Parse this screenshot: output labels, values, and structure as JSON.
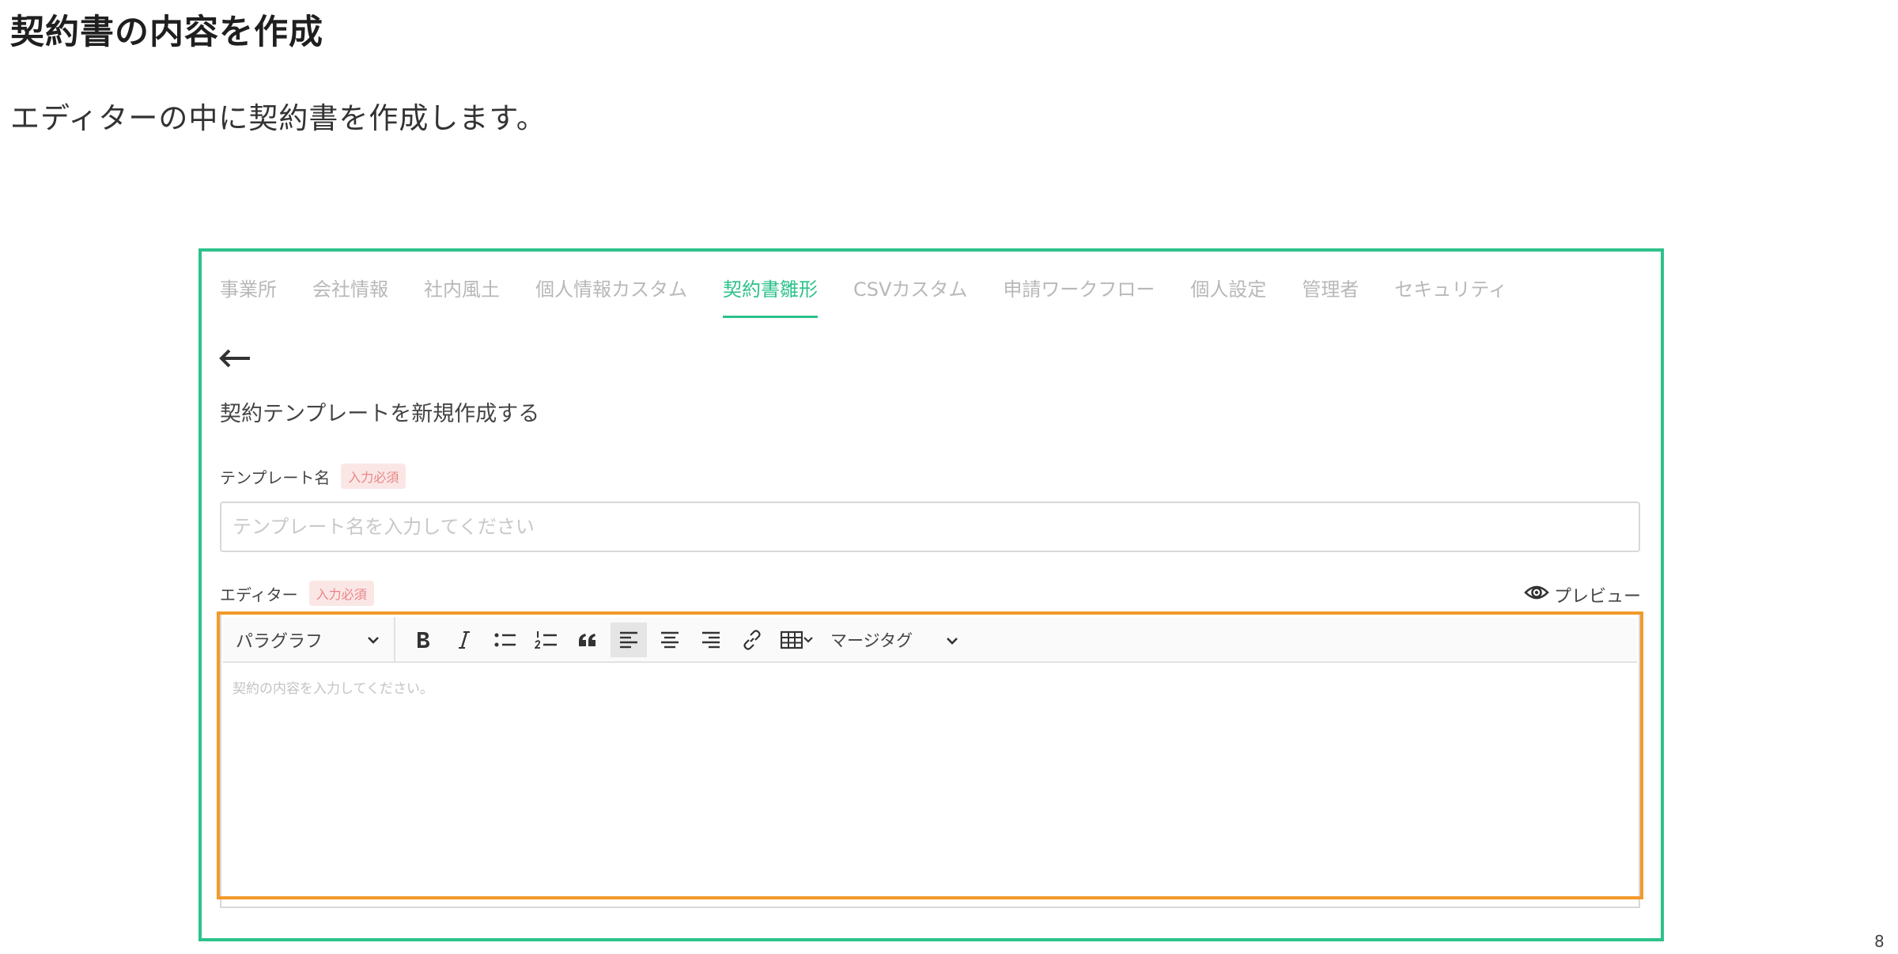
{
  "doc": {
    "heading": "契約書の内容を作成",
    "description": "エディターの中に契約書を作成します。",
    "page_number": "8"
  },
  "tabs": [
    {
      "label": "事業所",
      "active": false
    },
    {
      "label": "会社情報",
      "active": false
    },
    {
      "label": "社内風土",
      "active": false
    },
    {
      "label": "個人情報カスタム",
      "active": false
    },
    {
      "label": "契約書雛形",
      "active": true
    },
    {
      "label": "CSVカスタム",
      "active": false
    },
    {
      "label": "申請ワークフロー",
      "active": false
    },
    {
      "label": "個人設定",
      "active": false
    },
    {
      "label": "管理者",
      "active": false
    },
    {
      "label": "セキュリティ",
      "active": false
    }
  ],
  "form": {
    "title": "契約テンプレートを新規作成する",
    "required_badge": "入力必須",
    "template_name": {
      "label": "テンプレート名",
      "value": "",
      "placeholder": "テンプレート名を入力してください"
    },
    "editor": {
      "label": "エディター",
      "preview_label": "プレビュー",
      "paragraph_select": "パラグラフ",
      "merge_tag_select": "マージタグ",
      "placeholder": "契約の内容を入力してください。"
    }
  },
  "icons": {
    "back": "back-arrow-icon",
    "preview": "eye-icon",
    "toolbar": [
      "bold-icon",
      "italic-icon",
      "bulleted-list-icon",
      "numbered-list-icon",
      "blockquote-icon",
      "align-left-icon",
      "align-center-icon",
      "align-right-icon",
      "link-icon",
      "table-icon"
    ]
  },
  "colors": {
    "accent_green": "#2cc28b",
    "highlight_orange": "#f29a2a",
    "required_badge_text": "#e98585",
    "required_badge_bg": "#fbe6e6"
  }
}
